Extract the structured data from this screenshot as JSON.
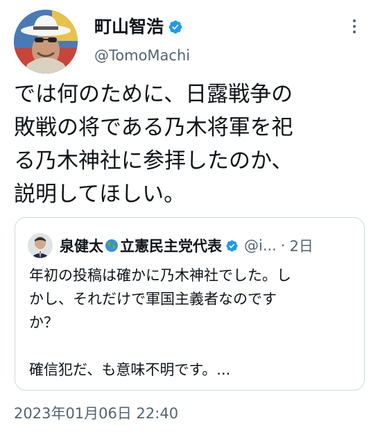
{
  "author": {
    "name": "町山智浩",
    "handle": "@TomoMachi",
    "verified_color": "#1d9bf0"
  },
  "tweet": {
    "text": "では何のために、日露戦争の\n敗戦の将である乃木将軍を祀\nる乃木神社に参拝したのか、\n説明してほしい。",
    "timestamp": "2023年01月06日 22:40"
  },
  "quoted": {
    "name_part1": "泉健太",
    "name_part2": "立憲民主党代表",
    "handle": "@i...",
    "dot": "·",
    "time": "2日",
    "text": "年初の投稿は確かに乃木神社でした。し\nかし、それだけで軍国主義者なのです\nか？\n\n確信犯だ、も意味不明です。..."
  },
  "icons": {
    "more": "more-options-icon",
    "verified": "verified-badge-icon",
    "globe": "globe-emoji-icon"
  }
}
